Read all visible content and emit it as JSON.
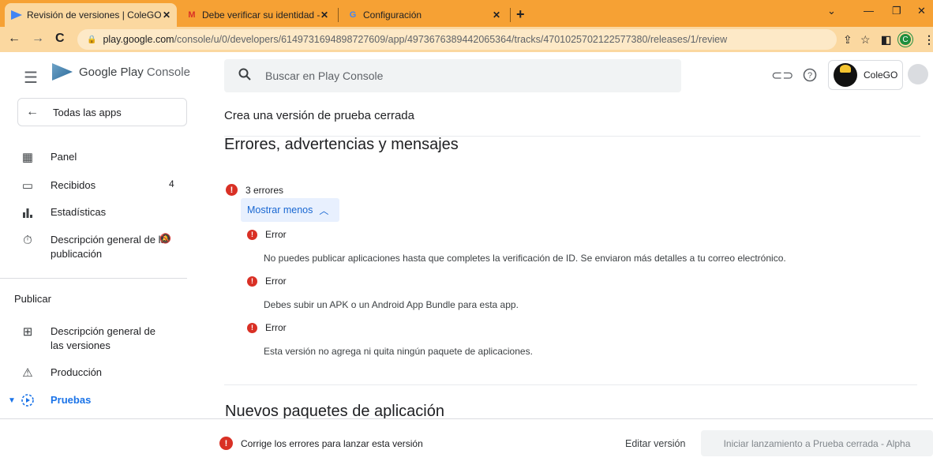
{
  "browser": {
    "tabs": [
      {
        "title": "Revisión de versiones | ColeGO",
        "icon": "play-console-icon"
      },
      {
        "title": "Debe verificar su identidad - serv",
        "icon": "gmail-icon"
      },
      {
        "title": "Configuración",
        "icon": "google-icon"
      }
    ],
    "url_host": "play.google.com",
    "url_path": "/console/u/0/developers/6149731694898727609/app/4973676389442065364/tracks/4701025702122577380/releases/1/review"
  },
  "header": {
    "logo_main": "Google Play",
    "logo_sub": "Console",
    "search_placeholder": "Buscar en Play Console",
    "account_name": "ColeGO"
  },
  "sidebar": {
    "all_apps": "Todas las apps",
    "items": [
      {
        "label": "Panel",
        "count": ""
      },
      {
        "label": "Recibidos",
        "count": "4"
      },
      {
        "label": "Estadísticas",
        "count": ""
      },
      {
        "label": "Descripción general de la publicación",
        "count": ""
      }
    ],
    "section": "Publicar",
    "publish_items": [
      {
        "label": "Descripción general de las versiones"
      },
      {
        "label": "Producción"
      },
      {
        "label": "Pruebas"
      }
    ]
  },
  "main": {
    "subtitle": "Crea una versión de prueba cerrada",
    "section_title": "Errores, advertencias y mensajes",
    "error_count": "3 errores",
    "show_less": "Mostrar menos",
    "errors": [
      {
        "title": "Error",
        "message": "No puedes publicar aplicaciones hasta que completes la verificación de ID. Se enviaron más detalles a tu correo electrónico."
      },
      {
        "title": "Error",
        "message": "Debes subir un APK o un Android App Bundle para esta app."
      },
      {
        "title": "Error",
        "message": "Esta versión no agrega ni quita ningún paquete de aplicaciones."
      }
    ],
    "next_section_title": "Nuevos paquetes de aplicación"
  },
  "footer": {
    "message": "Corrige los errores para lanzar esta versión",
    "edit_button": "Editar versión",
    "launch_button": "Iniciar lanzamiento a Prueba cerrada - Alpha"
  },
  "colors": {
    "accent": "#1a73e8",
    "error": "#d93025",
    "browser_frame": "#f6a134"
  }
}
